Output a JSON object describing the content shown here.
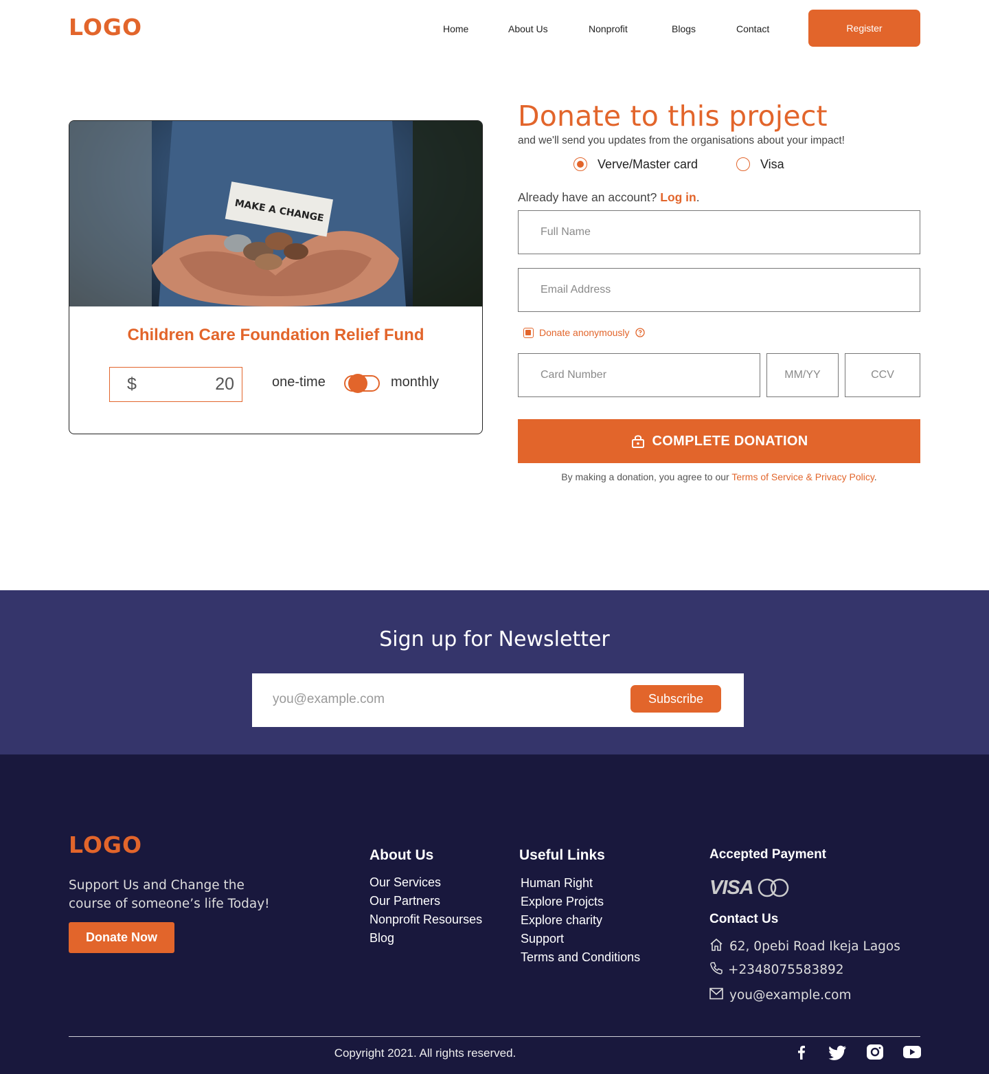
{
  "header": {
    "logo": "LOGO",
    "nav": [
      "Home",
      "About Us",
      "Nonprofit",
      "Blogs",
      "Contact"
    ],
    "register_label": "Register"
  },
  "project": {
    "image_text": "MAKE A CHANGE",
    "title": "Children Care Foundation Relief Fund",
    "currency": "$",
    "amount": "20",
    "one_time_label": "one-time",
    "monthly_label": "monthly"
  },
  "donation": {
    "title": "Donate to this project",
    "subtitle": "and we'll send you updates from the organisations about your impact!",
    "payment_options": [
      {
        "label": "Verve/Master card",
        "selected": true
      },
      {
        "label": "Visa",
        "selected": false
      }
    ],
    "account_prompt": "Already have an account?",
    "login_label": "Log in",
    "account_end": ".",
    "full_name_placeholder": "Full Name",
    "email_placeholder": "Email Address",
    "anonymous_label": "Donate anonymously",
    "anonymous_checked": true,
    "card_number_placeholder": "Card Number",
    "expiry_placeholder": "MM/YY",
    "ccv_placeholder": "CCV",
    "complete_label": "COMPLETE DONATION",
    "terms_prefix": "By making a donation, you agree to our",
    "terms_link": "Terms of Service & Privacy Policy",
    "terms_end": "."
  },
  "newsletter": {
    "title": "Sign up for Newsletter",
    "email_placeholder": "you@example.com",
    "subscribe_label": "Subscribe"
  },
  "footer": {
    "logo": "LOGO",
    "tagline": "Support Us and Change the course of someone’s life Today!",
    "donate_now_label": "Donate Now",
    "about_heading": "About Us",
    "about_links": [
      "Our Services",
      "Our Partners",
      "Nonprofit Resourses",
      "Blog"
    ],
    "useful_heading": "Useful Links",
    "useful_links": [
      "Human Right",
      "Explore Projcts",
      "Explore charity",
      "Support",
      "Terms and Conditions"
    ],
    "payment_heading": "Accepted Payment",
    "visa_text": "VISA",
    "contact_heading": "Contact Us",
    "address": "62, 0pebi Road  Ikeja Lagos",
    "phone": "+2348075583892",
    "email": "you@example.com",
    "copyright": "Copyright 2021. All rights reserved."
  },
  "colors": {
    "accent": "#E2652B",
    "newsletter_bg": "#35356b",
    "footer_bg": "#19183d"
  }
}
